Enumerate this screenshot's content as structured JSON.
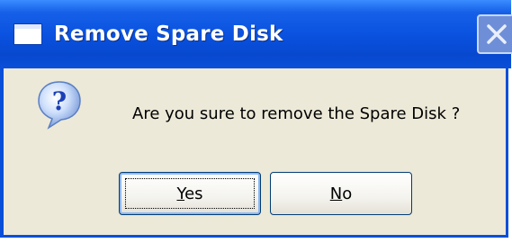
{
  "dialog": {
    "title": "Remove Spare Disk",
    "message": "Are you sure to remove the Spare Disk ?",
    "buttons": {
      "yes": {
        "mnemonic": "Y",
        "rest": "es"
      },
      "no": {
        "mnemonic": "N",
        "rest": "o"
      }
    },
    "icons": {
      "title_icon": "window-icon",
      "message_icon": "question-icon",
      "close": "close-icon"
    }
  },
  "colors": {
    "titlebar": "#0a52e0",
    "window_bg": "#ece9d8",
    "title_text": "#ffffff"
  }
}
